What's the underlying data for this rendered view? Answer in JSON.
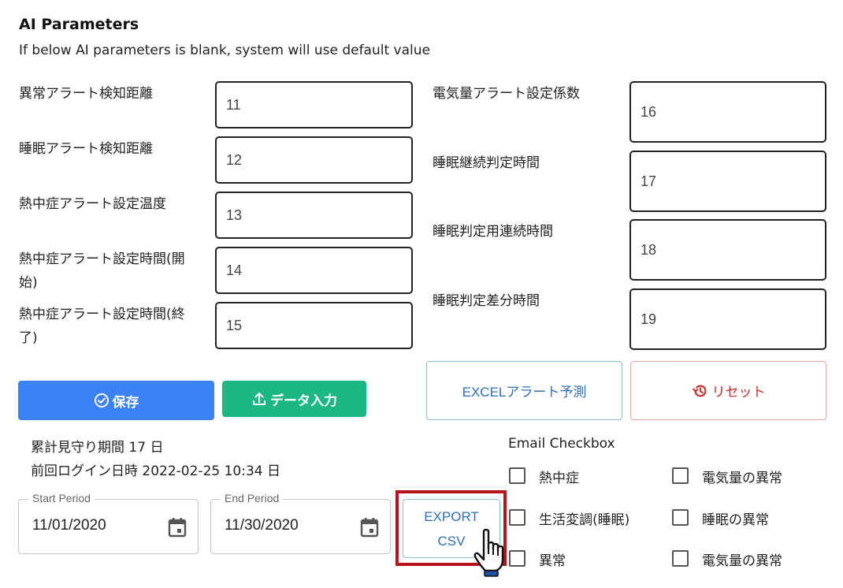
{
  "header": {
    "title": "AI Parameters",
    "subtitle": "If below AI parameters is blank, system will use default value"
  },
  "left_params": [
    {
      "label": "異常アラート検知距離",
      "value": "11"
    },
    {
      "label": "睡眠アラート検知距離",
      "value": "12"
    },
    {
      "label": "熱中症アラート設定温度",
      "value": "13"
    },
    {
      "label": "熱中症アラート設定時間(開始)",
      "label_line1": "熱中症アラート設定時間(開",
      "label_line2": "始)",
      "value": "14"
    },
    {
      "label": "熱中症アラート設定時間(終了)",
      "label_line1": "熱中症アラート設定時間(終",
      "label_line2": "了)",
      "value": "15"
    }
  ],
  "right_params": [
    {
      "label": "電気量アラート設定係数",
      "value": "16"
    },
    {
      "label": "睡眠継続判定時間",
      "value": "17"
    },
    {
      "label": "睡眠判定用連続時間",
      "value": "18"
    },
    {
      "label": "睡眠判定差分時間",
      "value": "19"
    }
  ],
  "buttons": {
    "save": "保存",
    "data_import": "データ入力",
    "excel_alert": "EXCELアラート予測",
    "reset": "リセット"
  },
  "info": {
    "watch_period": "累計見守り期間 17 日",
    "last_login": "前回ログイン日時 2022-02-25 10:34 日"
  },
  "period": {
    "start_label": "Start Period",
    "start_value": "11/01/2020",
    "end_label": "End Period",
    "end_value": "11/30/2020"
  },
  "export": {
    "line1": "EXPORT",
    "line2": "CSV"
  },
  "email": {
    "title": "Email Checkbox",
    "options": [
      {
        "label": "熱中症",
        "checked": false
      },
      {
        "label": "電気量の異常",
        "checked": false
      },
      {
        "label": "生活変調(睡眠)",
        "checked": false
      },
      {
        "label": "睡眠の異常",
        "checked": false
      },
      {
        "label": "異常",
        "checked": false
      },
      {
        "label": "電気量の異常",
        "checked": false
      }
    ]
  },
  "colors": {
    "save": "#3b82f6",
    "import": "#1db784",
    "excel_text": "#2f6fb8",
    "reset_text": "#c8302a",
    "highlight": "#b5121b"
  }
}
